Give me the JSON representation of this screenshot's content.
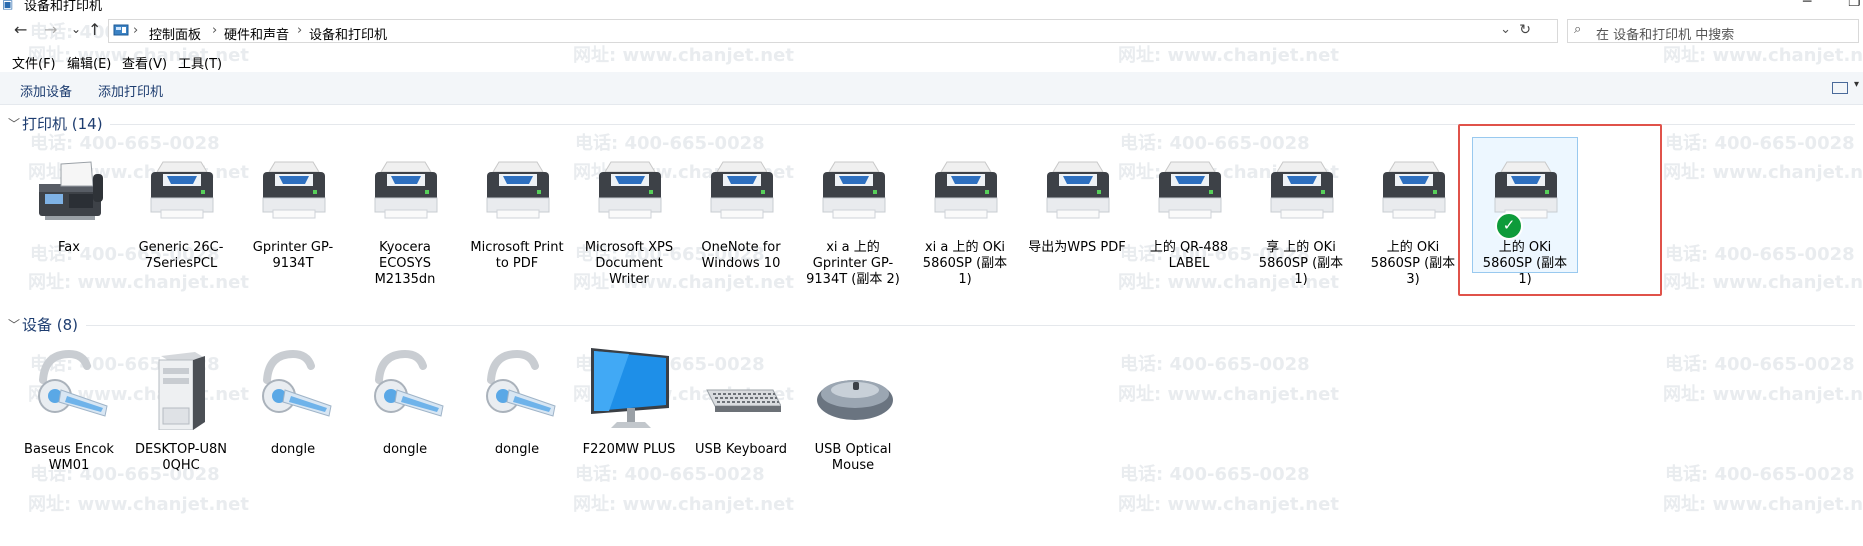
{
  "window": {
    "title": "设备和打印机"
  },
  "nav": {
    "back": "←",
    "forward": "→",
    "recent": "⌄",
    "up": "↑"
  },
  "breadcrumb": [
    "控制面板",
    "硬件和声音",
    "设备和打印机"
  ],
  "search": {
    "placeholder": "在 设备和打印机 中搜索"
  },
  "menu": [
    "文件(F)",
    "编辑(E)",
    "查看(V)",
    "工具(T)"
  ],
  "commands": [
    "添加设备",
    "添加打印机"
  ],
  "watermark": {
    "phone": "电话: 400-665-0028",
    "site": "网址: www.chanjet.net"
  },
  "groups": {
    "printers": {
      "title": "打印机 (14)",
      "items": [
        {
          "label": "Fax",
          "icon": "fax-icon"
        },
        {
          "label": "Generic 26C-7SeriesPCL",
          "icon": "printer-icon"
        },
        {
          "label": "Gprinter GP-9134T",
          "icon": "printer-icon"
        },
        {
          "label": "Kyocera ECOSYS M2135dn",
          "icon": "printer-icon"
        },
        {
          "label": "Microsoft Print to PDF",
          "icon": "printer-icon"
        },
        {
          "label": "Microsoft XPS Document Writer",
          "icon": "printer-icon"
        },
        {
          "label": "OneNote for Windows 10",
          "icon": "printer-icon"
        },
        {
          "label": "xi a 上的 Gprinter GP-9134T (副本 2)",
          "icon": "printer-icon"
        },
        {
          "label": "xi a 上的 OKi 5860SP (副本 1)",
          "icon": "printer-icon"
        },
        {
          "label": "导出为WPS PDF",
          "icon": "printer-icon"
        },
        {
          "label": "上的 QR-488 LABEL",
          "icon": "printer-icon"
        },
        {
          "label": "享 上的 OKi 5860SP (副本 1)",
          "icon": "printer-icon"
        },
        {
          "label": "上的 OKi 5860SP (副本 3)",
          "icon": "printer-icon"
        },
        {
          "label": "上的 OKi 5860SP (副本 1)",
          "icon": "printer-icon",
          "default": true,
          "selected": true
        }
      ]
    },
    "devices": {
      "title": "设备 (8)",
      "items": [
        {
          "label": "Baseus Encok WM01",
          "icon": "headset-icon"
        },
        {
          "label": "DESKTOP-U8N 0QHC",
          "icon": "computer-tower-icon"
        },
        {
          "label": "dongle",
          "icon": "headset-icon"
        },
        {
          "label": "dongle",
          "icon": "headset-icon"
        },
        {
          "label": "dongle",
          "icon": "headset-icon"
        },
        {
          "label": "F220MW PLUS",
          "icon": "monitor-icon"
        },
        {
          "label": "USB Keyboard",
          "icon": "keyboard-icon"
        },
        {
          "label": "USB Optical Mouse",
          "icon": "mouse-icon"
        }
      ]
    }
  },
  "colors": {
    "accent": "#1e3d70",
    "selection_outline": "#e0524a",
    "selection_fill": "#cce8ff",
    "default_check": "#0e9b3a"
  }
}
